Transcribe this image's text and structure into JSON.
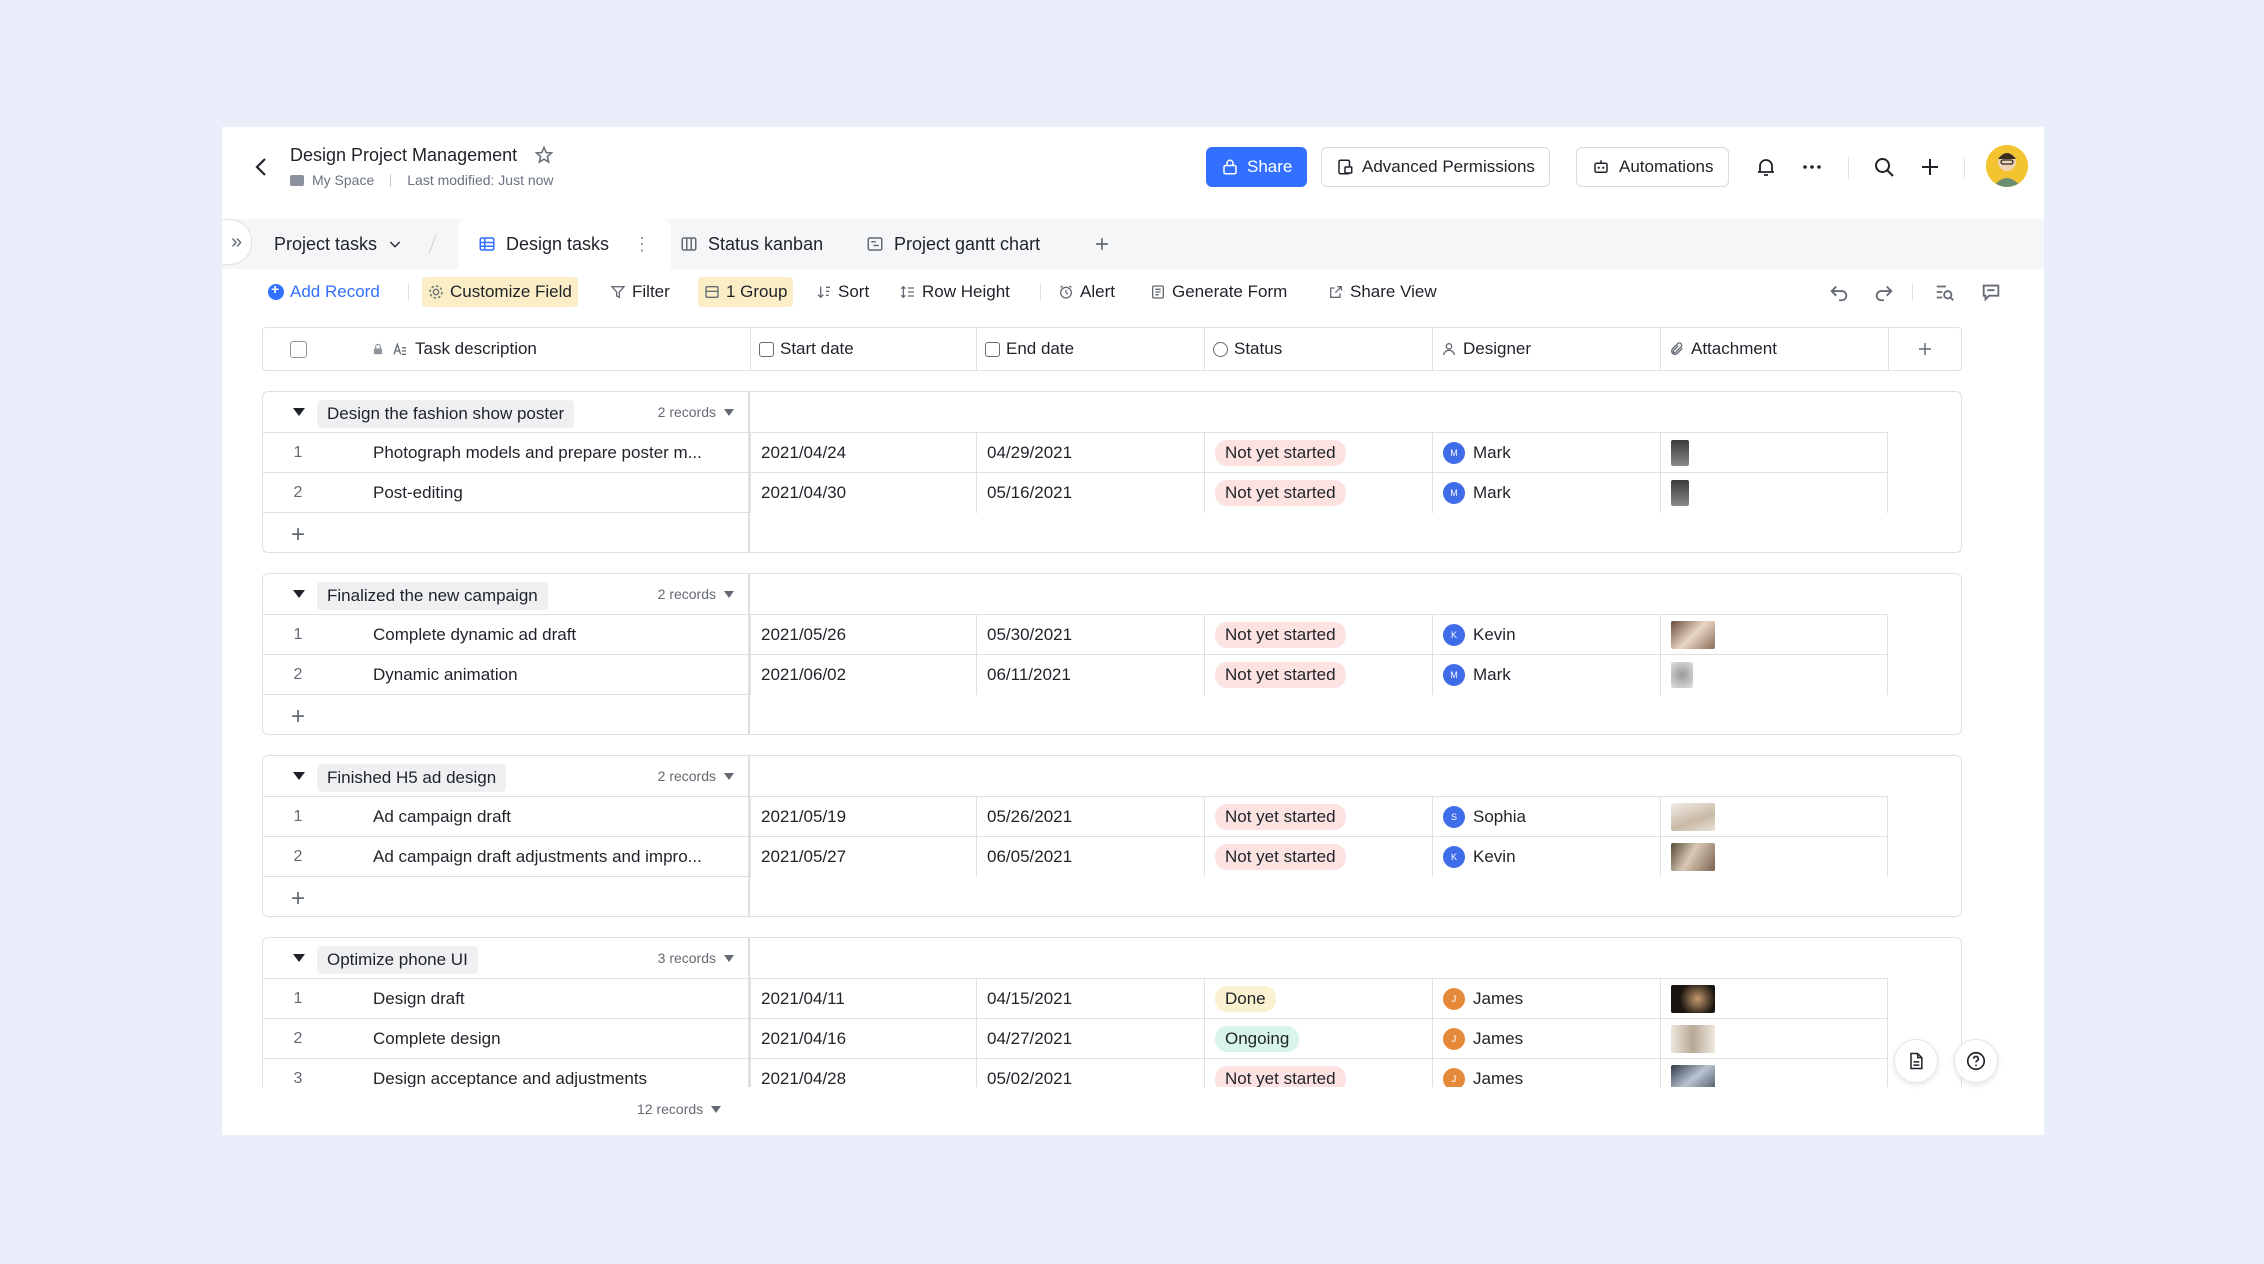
{
  "app": {
    "title": "Design Project Management",
    "space": "My Space",
    "last_modified": "Last modified: Just now"
  },
  "header_buttons": {
    "share": "Share",
    "advanced_permissions": "Advanced Permissions",
    "automations": "Automations"
  },
  "tabs": {
    "table_selector": "Project tasks",
    "items": [
      {
        "label": "Design tasks",
        "active": true
      },
      {
        "label": "Status kanban"
      },
      {
        "label": "Project gantt chart"
      }
    ]
  },
  "toolbar": {
    "add_record": "Add Record",
    "customize_field": "Customize Field",
    "filter": "Filter",
    "group": "1 Group",
    "sort": "Sort",
    "row_height": "Row Height",
    "alert": "Alert",
    "generate_form": "Generate Form",
    "share_view": "Share View"
  },
  "columns": {
    "task": "Task description",
    "start": "Start date",
    "end": "End date",
    "status": "Status",
    "designer": "Designer",
    "attachment": "Attachment"
  },
  "groups": [
    {
      "name": "Design the fashion show poster",
      "count": "2 records",
      "rows": [
        {
          "idx": "1",
          "task": "Photograph models and prepare poster m...",
          "start": "2021/04/24",
          "end": "04/29/2021",
          "status": "Not yet started",
          "designer": "Mark",
          "initial": "M"
        },
        {
          "idx": "2",
          "task": "Post-editing",
          "start": "2021/04/30",
          "end": "05/16/2021",
          "status": "Not yet started",
          "designer": "Mark",
          "initial": "M"
        }
      ]
    },
    {
      "name": "Finalized the new campaign",
      "count": "2 records",
      "rows": [
        {
          "idx": "1",
          "task": "Complete dynamic ad draft",
          "start": "2021/05/26",
          "end": "05/30/2021",
          "status": "Not yet started",
          "designer": "Kevin",
          "initial": "K"
        },
        {
          "idx": "2",
          "task": "Dynamic animation",
          "start": "2021/06/02",
          "end": "06/11/2021",
          "status": "Not yet started",
          "designer": "Mark",
          "initial": "M"
        }
      ]
    },
    {
      "name": "Finished H5 ad design",
      "count": "2 records",
      "rows": [
        {
          "idx": "1",
          "task": "Ad campaign draft",
          "start": "2021/05/19",
          "end": "05/26/2021",
          "status": "Not yet started",
          "designer": "Sophia",
          "initial": "S"
        },
        {
          "idx": "2",
          "task": "Ad campaign draft adjustments and impro...",
          "start": "2021/05/27",
          "end": "06/05/2021",
          "status": "Not yet started",
          "designer": "Kevin",
          "initial": "K"
        }
      ]
    },
    {
      "name": "Optimize phone UI",
      "count": "3 records",
      "rows": [
        {
          "idx": "1",
          "task": "Design draft",
          "start": "2021/04/11",
          "end": "04/15/2021",
          "status": "Done",
          "designer": "James",
          "initial": "J"
        },
        {
          "idx": "2",
          "task": "Complete design",
          "start": "2021/04/16",
          "end": "04/27/2021",
          "status": "Ongoing",
          "designer": "James",
          "initial": "J"
        },
        {
          "idx": "3",
          "task": "Design acceptance and adjustments",
          "start": "2021/04/28",
          "end": "05/02/2021",
          "status": "Not yet started",
          "designer": "James",
          "initial": "J"
        }
      ]
    }
  ],
  "footer": {
    "total": "12 records"
  },
  "colors": {
    "accent": "#3370ff",
    "avatar_blue": "#3f6ce8",
    "avatar_orange": "#e58a3a",
    "status_not_started": "#fde2e2",
    "status_done": "#faf1d1",
    "status_ongoing": "#d9f5ea"
  }
}
